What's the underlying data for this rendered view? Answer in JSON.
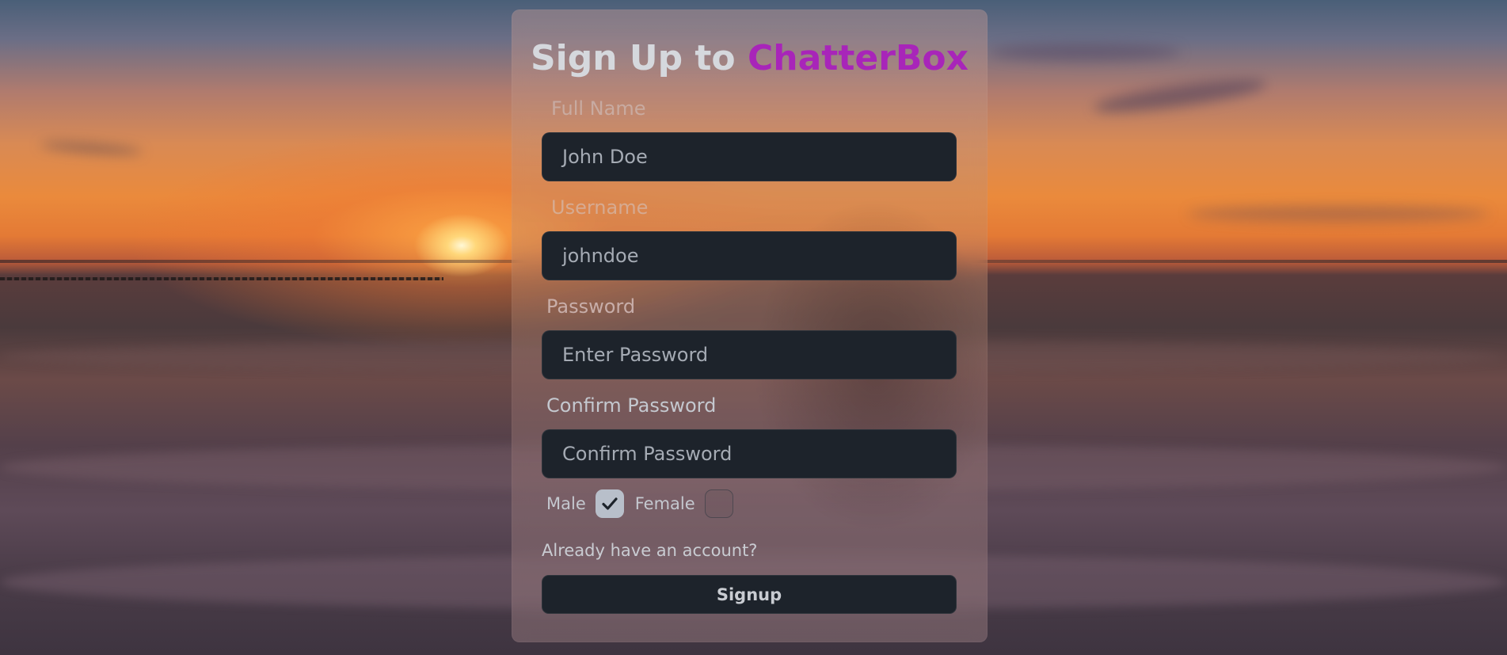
{
  "title": {
    "prefix": "Sign Up to ",
    "brand": "ChatterBox"
  },
  "form": {
    "full_name": {
      "label": "Full Name",
      "value": "John Doe"
    },
    "username": {
      "label": "Username",
      "value": "johndoe"
    },
    "password": {
      "label": "Password",
      "placeholder": "Enter Password"
    },
    "confirm_password": {
      "label": "Confirm Password",
      "placeholder": "Confirm Password"
    },
    "gender": {
      "male_label": "Male",
      "male_checked": true,
      "female_label": "Female",
      "female_checked": false
    },
    "login_link": "Already have an account?",
    "submit_label": "Signup"
  },
  "colors": {
    "brand": "#a825b9",
    "input_bg": "#1d232b"
  }
}
